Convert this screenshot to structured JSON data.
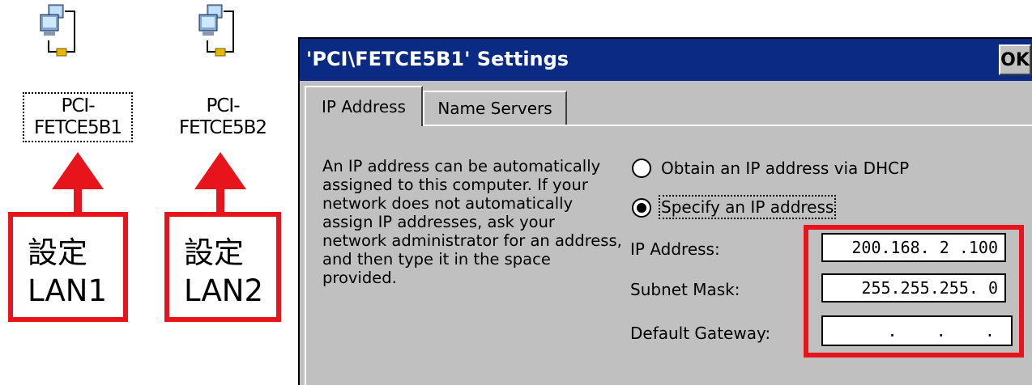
{
  "desktop": {
    "icons": [
      {
        "label_line1": "PCI-",
        "label_line2": "FETCE5B1",
        "icon": "network-computer-icon"
      },
      {
        "label_line1": "PCI-",
        "label_line2": "FETCE5B2",
        "icon": "network-computer-icon"
      }
    ],
    "callouts": [
      {
        "line1": "設定",
        "line2": "LAN1"
      },
      {
        "line1": "設定",
        "line2": "LAN2"
      }
    ],
    "accent_red": "#e8141b"
  },
  "dialog": {
    "title": "'PCI\\FETCE5B1' Settings",
    "ok_label": "OK",
    "tabs": [
      {
        "label": "IP Address",
        "active": true
      },
      {
        "label": "Name Servers",
        "active": false
      }
    ],
    "description": "An IP address can be automatically assigned to this computer.  If your network does not automatically assign IP addresses, ask your network administrator for an address, and then type it in the space provided.",
    "options": {
      "dhcp": {
        "label": "Obtain an IP address via DHCP",
        "selected": false
      },
      "specify": {
        "label": "Specify an IP address",
        "selected": true
      }
    },
    "fields": {
      "ip_address": {
        "label": "IP Address:",
        "value": "200.168. 2 .100"
      },
      "subnet_mask": {
        "label": "Subnet Mask:",
        "value": "255.255.255. 0"
      },
      "default_gateway": {
        "label": "Default Gateway:",
        "value": " .    .    . "
      }
    },
    "colors": {
      "titlebar": "#0b2a84",
      "face": "#c0c0c0"
    }
  }
}
